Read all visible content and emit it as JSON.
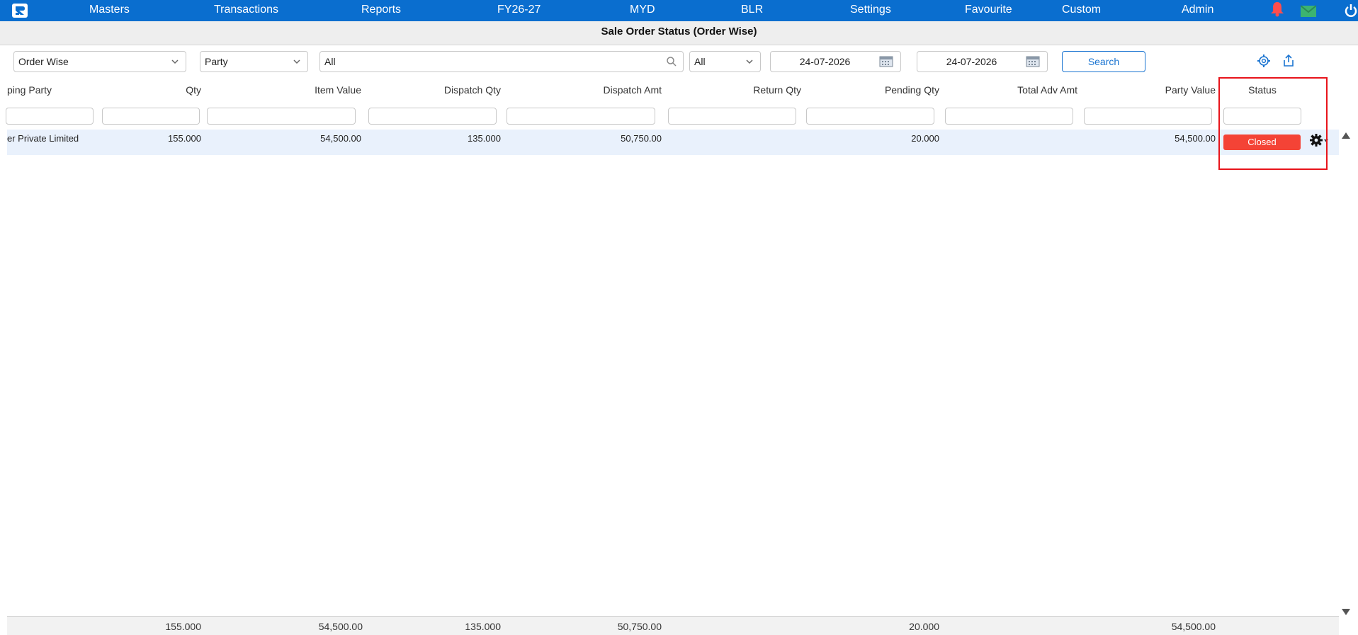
{
  "nav": {
    "logo": "logo-icon",
    "items": [
      "Masters",
      "Transactions",
      "Reports",
      "FY26-27",
      "MYD",
      "BLR",
      "Settings",
      "Favourite",
      "Custom",
      "Admin"
    ],
    "icons": [
      "bell-icon",
      "mail-icon",
      "power-icon"
    ]
  },
  "page_title": "Sale Order Status (Order Wise)",
  "filters": {
    "view": "Order Wise",
    "group": "Party",
    "search_value": "All",
    "status": "All",
    "from_date": "24-07-2026",
    "to_date": "24-07-2026",
    "search_button": "Search"
  },
  "columns": [
    "ping Party",
    "Qty",
    "Item Value",
    "Dispatch Qty",
    "Dispatch Amt",
    "Return Qty",
    "Pending Qty",
    "Total Adv Amt",
    "Party Value",
    "Status"
  ],
  "rows": [
    {
      "party": "er Private Limited",
      "qty": "155.000",
      "item_value": "54,500.00",
      "dispatch_qty": "135.000",
      "dispatch_amt": "50,750.00",
      "return_qty": "",
      "pending_qty": "20.000",
      "total_adv_amt": "",
      "party_value": "54,500.00",
      "status": "Closed"
    }
  ],
  "totals": {
    "qty": "155.000",
    "item_value": "54,500.00",
    "dispatch_qty": "135.000",
    "dispatch_amt": "50,750.00",
    "pending_qty": "20.000",
    "party_value": "54,500.00"
  },
  "colors": {
    "nav_bg": "#0a6ecf",
    "row_bg": "#e9f1fc",
    "status_closed": "#f44336",
    "highlight": "#e8141b",
    "bell": "#ff4d4d",
    "mail": "#3cb371"
  }
}
